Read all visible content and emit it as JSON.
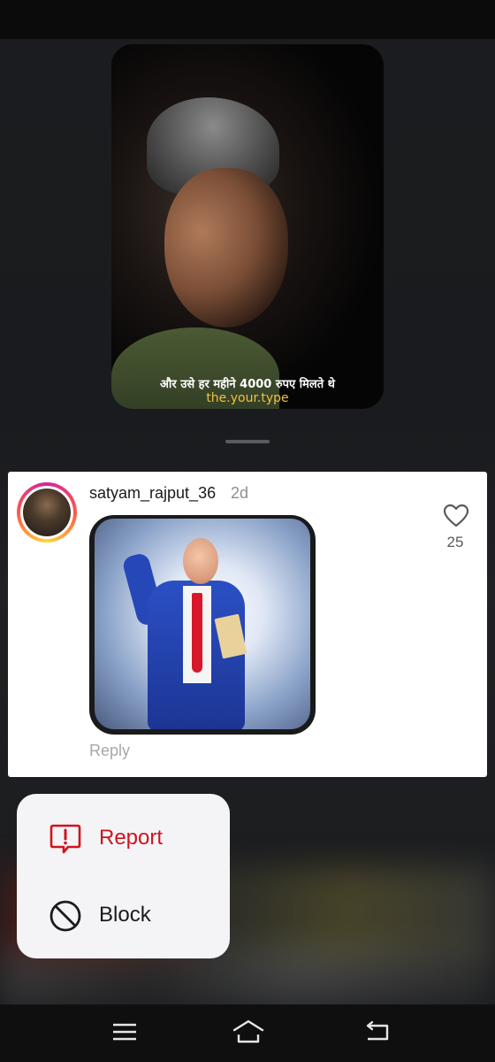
{
  "reel": {
    "caption": "और उसे हर महीने 4000 रुपए मिलते थे",
    "handle": "the.your.type"
  },
  "comment": {
    "username": "satyam_rajput_36",
    "time": "2d",
    "like_count": "25",
    "reply_label": "Reply"
  },
  "menu": {
    "report_label": "Report",
    "block_label": "Block",
    "report_color": "#d1131d"
  },
  "nav": {
    "icons": [
      "menu-icon",
      "home-icon",
      "back-icon"
    ]
  }
}
